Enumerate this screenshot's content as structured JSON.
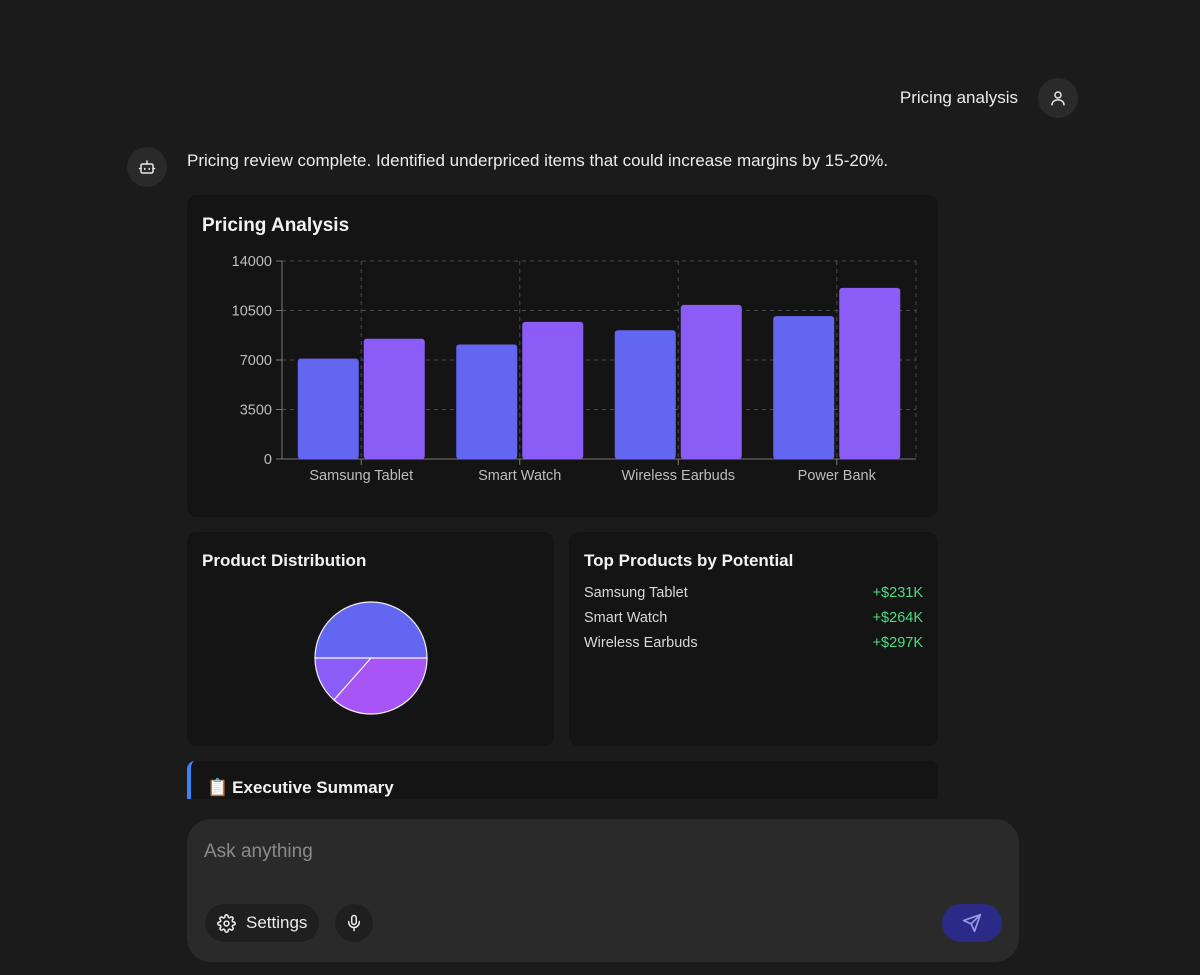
{
  "user_message": {
    "text": "Pricing analysis",
    "icon": "user-icon"
  },
  "assistant": {
    "icon": "robot-icon",
    "text": "Pricing review complete. Identified underpriced items that could increase margins by 15-20%."
  },
  "pricing_card": {
    "title": "Pricing Analysis"
  },
  "distribution_card": {
    "title": "Product Distribution"
  },
  "top_products": {
    "title": "Top Products by Potential",
    "items": [
      {
        "name": "Samsung Tablet",
        "value": "+$231K"
      },
      {
        "name": "Smart Watch",
        "value": "+$264K"
      },
      {
        "name": "Wireless Earbuds",
        "value": "+$297K"
      }
    ]
  },
  "executive_summary": {
    "icon": "clipboard-icon",
    "emoji": "📋",
    "title": "Executive Summary"
  },
  "composer": {
    "placeholder": "Ask anything",
    "settings_label": "Settings",
    "settings_icon": "gear-icon",
    "mic_icon": "microphone-icon",
    "send_icon": "send-icon"
  },
  "colors": {
    "series_a": "#6366f1",
    "series_b": "#8b5cf6",
    "pie_c": "#a855f7",
    "positive": "#4ade80",
    "accent_border": "#3b82f6"
  },
  "chart_data": [
    {
      "type": "bar",
      "title": "Pricing Analysis",
      "categories": [
        "Samsung Tablet",
        "Smart Watch",
        "Wireless Earbuds",
        "Power Bank"
      ],
      "series": [
        {
          "values": [
            7100,
            8100,
            9100,
            10100
          ]
        },
        {
          "values": [
            8500,
            9700,
            10900,
            12100
          ]
        }
      ],
      "ylim": [
        0,
        14000
      ],
      "yticks": [
        "0",
        "3500",
        "7000",
        "10500",
        "14000"
      ],
      "grid": true,
      "xlabel": "",
      "ylabel": ""
    },
    {
      "type": "pie",
      "title": "Product Distribution",
      "slices": [
        {
          "value": 50
        },
        {
          "value": 13.5
        },
        {
          "value": 36.5
        }
      ]
    }
  ]
}
